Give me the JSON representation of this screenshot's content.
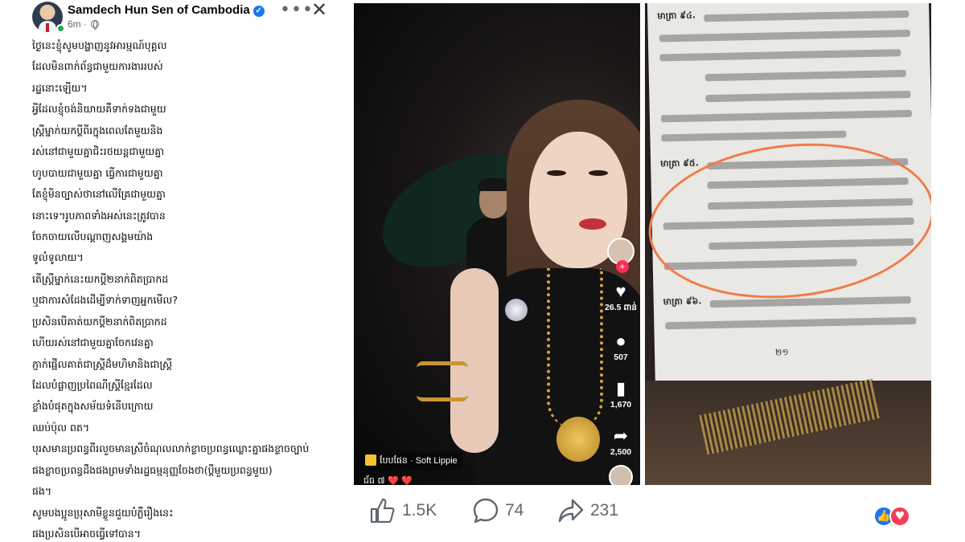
{
  "post": {
    "author": "Samdech Hun Sen of Cambodia",
    "time": "6m",
    "lines": [
      "ថ្ងៃនេះខ្ញុំសូមបង្ហាញនូវអារម្មណ៍បុគ្គល",
      "ដែលមិនពាក់ព័ន្ធជាមួយការងាររបស់",
      "រដ្ឋនោះឡើយ។",
      "អ្វីដែលខ្ញុំចង់និយាយគឺទាក់ទងជាមួយ",
      "ស្ត្រីម្នាក់យកប្តីពីរក្នុងពេលតែមួយនិង",
      "រស់នៅជាមួយគ្នាជិះរថយន្តជាមួយគ្នា",
      "ហូបបាយជាមួយគ្នា ធ្វើការជាមួយគ្នា",
      "តែខ្ញុំមិនច្បាស់ថានៅលើគ្រែជាមួយគ្នា",
      "នោះទេ។រូបភាពទាំងអស់នេះត្រូវបាន",
      "ចែកចាយលើបណ្តាញសង្គមយ៉ាង",
      "ទូលំទូលាយ។",
      "តើស្ត្រីម្នាក់នេះយកប្តី២នាក់ពិតប្រាកដ",
      "ឬជាការសំដែងដើម្បីទាក់ទាញអ្នកមើល?",
      "ប្រសិនបើគាត់យកប្តី២នាក់ពិតប្រាកដ",
      "ហើយរស់នៅជាមួយគ្នាចែកវេនគ្នា",
      "ភ្ញាក់ផ្អើលគាត់ជាស្ត្រីដ៏មហិមានិងជាស្ត្រី",
      "ដែលបំផ្លាញប្រពៃណីស្ត្រីខ្មែរដែល",
      "ខ្លាំងបំផុតក្នុងសម័យទំនើបក្រោយ",
      "ឈប់ប៉ុល ពត។",
      "បុរសមានប្រពន្ធពីរលួចមានស្រីចំណុលលាក់ខ្លាចប្រពន្ធឈ្លោះគ្នាផងខ្លាចច្បាប់",
      "ផងខ្លាចប្រពន្ធដឹងផងព្រមទាំងរដ្ឋធម្មនុញ្ញចែងថា(ប្តីមួយប្រពន្ធមួយ)",
      "ផង។",
      "សូមបងប្អូនប្រុសាមីខ្លួនជួយបំភ្លឺរឿងនេះ",
      "ផងប្រសិនបើអាចធ្វើទៅបាន។"
    ]
  },
  "video": {
    "counts": {
      "likes": "26.5 ពាន់",
      "comments": "507",
      "saves": "1,670",
      "shares": "2,500"
    },
    "sound_label": "បែបផែន · Soft Lippie",
    "caption_text": "ជ័ធ ៧ ❤️ ❤️"
  },
  "document": {
    "headings": [
      "មាត្រា ៩៤.",
      "មាត្រា ៩៥.",
      "មាត្រា ៩៦."
    ],
    "page_number": "២១"
  },
  "actions": {
    "likes": "1.5K",
    "comments": "74",
    "shares": "231"
  },
  "colors": {
    "accent": "#1877f2",
    "love": "#f33e58",
    "highlight": "#f07b4a"
  }
}
